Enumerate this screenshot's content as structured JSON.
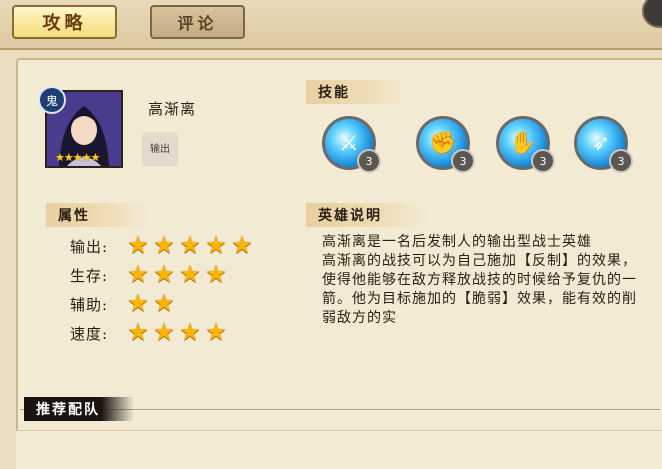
{
  "tabs": {
    "guide": "攻略",
    "comment": "评论"
  },
  "hero": {
    "name": "高渐离",
    "faction_badge": "鬼",
    "role_badge": "输出",
    "stars": "★★★★★"
  },
  "skills": {
    "title": "技能",
    "items": [
      {
        "level": "3",
        "icon": "sword-skill-icon"
      },
      {
        "level": "3",
        "icon": "fist-skill-icon"
      },
      {
        "level": "3",
        "icon": "glove-skill-icon"
      },
      {
        "level": "3",
        "icon": "arrow-skill-icon"
      }
    ]
  },
  "attributes": {
    "title": "属性",
    "rows": [
      {
        "label": "输出:",
        "stars": 5
      },
      {
        "label": "生存:",
        "stars": 4
      },
      {
        "label": "辅助:",
        "stars": 2
      },
      {
        "label": "速度:",
        "stars": 4
      }
    ]
  },
  "description": {
    "title": "英雄说明",
    "lines": [
      "高渐离是一名后发制人的输出型战士英雄",
      "高渐离的战技可以为自己施加【反制】的效果，使得他能够在敌方释放战技的时候给予复仇的一箭。他为目标施加的【脆弱】效果，能有效的削弱敌方的实"
    ]
  },
  "team": {
    "title": "推荐配队"
  },
  "colors": {
    "star": "#ffb400",
    "tab_active": "#f4dc7a",
    "panel_bg": "#f3ead4"
  }
}
